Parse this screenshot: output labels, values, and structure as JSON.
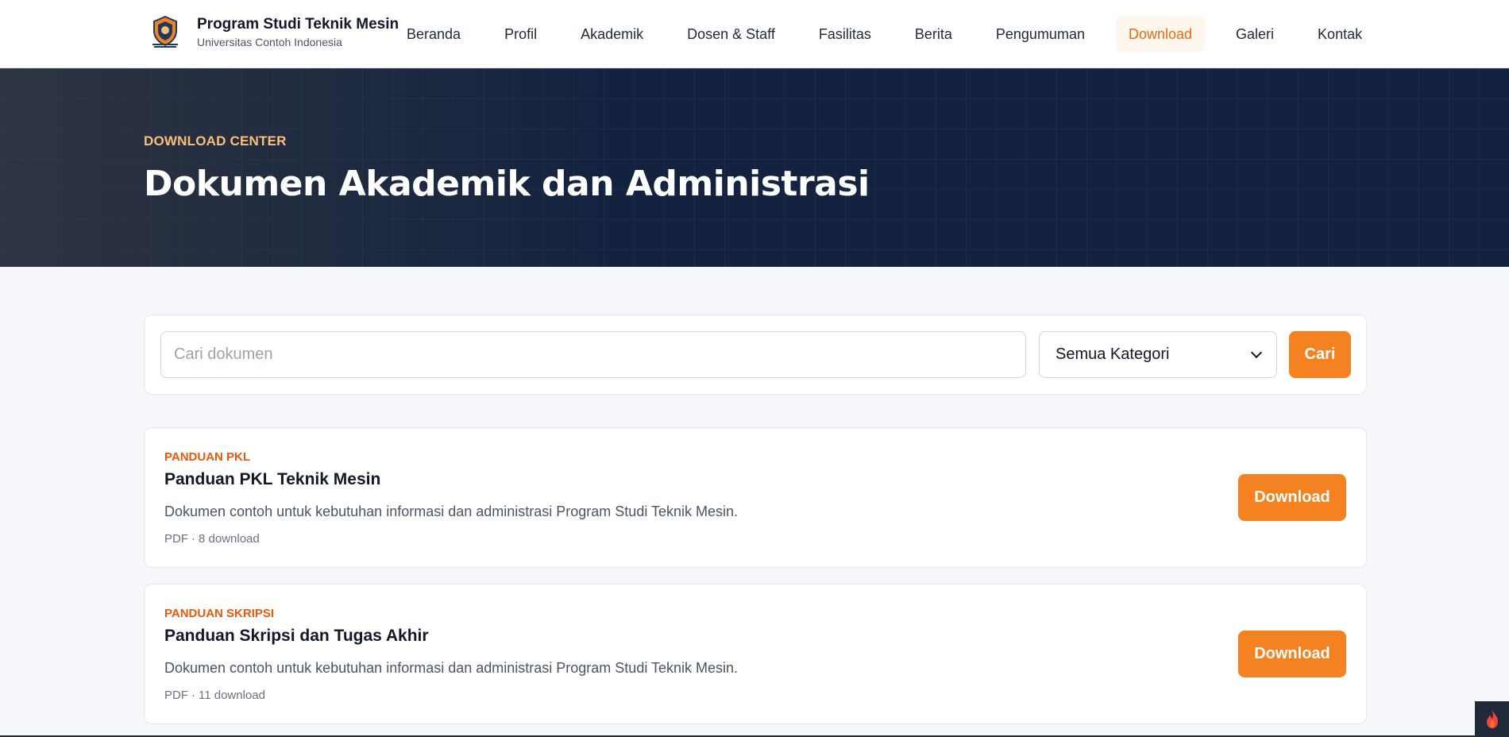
{
  "brand": {
    "title": "Program Studi Teknik Mesin",
    "subtitle": "Universitas Contoh Indonesia",
    "logo_icon": "university-shield-logo"
  },
  "nav": {
    "items": [
      {
        "label": "Beranda",
        "active": false
      },
      {
        "label": "Profil",
        "active": false
      },
      {
        "label": "Akademik",
        "active": false
      },
      {
        "label": "Dosen & Staff",
        "active": false
      },
      {
        "label": "Fasilitas",
        "active": false
      },
      {
        "label": "Berita",
        "active": false
      },
      {
        "label": "Pengumuman",
        "active": false
      },
      {
        "label": "Download",
        "active": true
      },
      {
        "label": "Galeri",
        "active": false
      },
      {
        "label": "Kontak",
        "active": false
      }
    ]
  },
  "hero": {
    "eyebrow": "DOWNLOAD CENTER",
    "title": "Dokumen Akademik dan Administrasi"
  },
  "search": {
    "placeholder": "Cari dokumen",
    "value": "",
    "category_selected": "Semua Kategori",
    "button_label": "Cari"
  },
  "documents": [
    {
      "category": "PANDUAN PKL",
      "title": "Panduan PKL Teknik Mesin",
      "description": "Dokumen contoh untuk kebutuhan informasi dan administrasi Program Studi Teknik Mesin.",
      "format": "PDF",
      "separator": "·",
      "downloads": "8 download",
      "button_label": "Download"
    },
    {
      "category": "PANDUAN SKRIPSI",
      "title": "Panduan Skripsi dan Tugas Akhir",
      "description": "Dokumen contoh untuk kebutuhan informasi dan administrasi Program Studi Teknik Mesin.",
      "format": "PDF",
      "separator": "·",
      "downloads": "11 download",
      "button_label": "Download"
    }
  ],
  "corner_widget": {
    "icon": "flame-icon"
  },
  "colors": {
    "accent": "#f58220",
    "accent_text": "#ea580c",
    "hero_bg": "#13233f",
    "eyebrow": "#fbbf77"
  }
}
